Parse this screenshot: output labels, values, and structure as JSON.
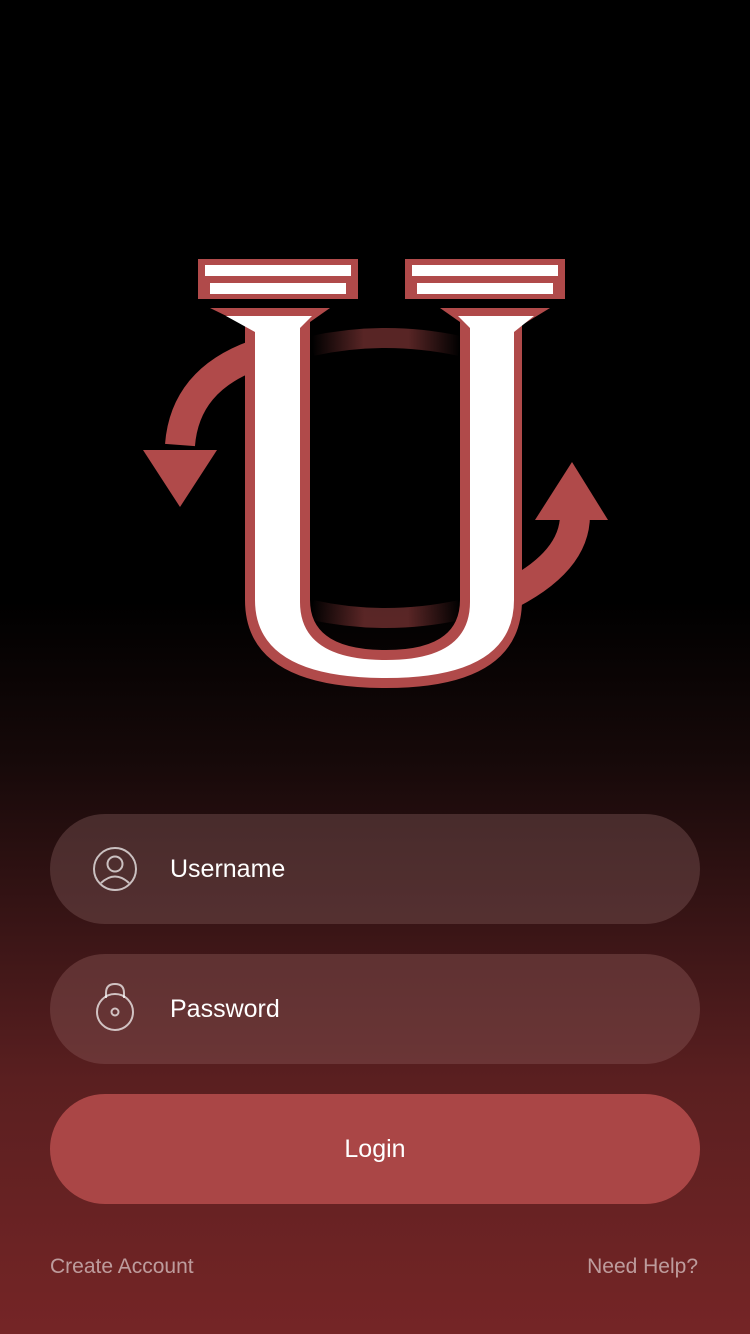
{
  "brand": {
    "logo_icon": "pillar-u-logo",
    "accent_color": "#b04a4a",
    "background_top": "#000000",
    "background_bottom": "#752526"
  },
  "form": {
    "username": {
      "placeholder": "Username",
      "value": "",
      "icon": "user-icon"
    },
    "password": {
      "placeholder": "Password",
      "value": "",
      "icon": "lock-icon"
    },
    "login_label": "Login"
  },
  "links": {
    "create_account": "Create Account",
    "need_help": "Need Help?"
  }
}
